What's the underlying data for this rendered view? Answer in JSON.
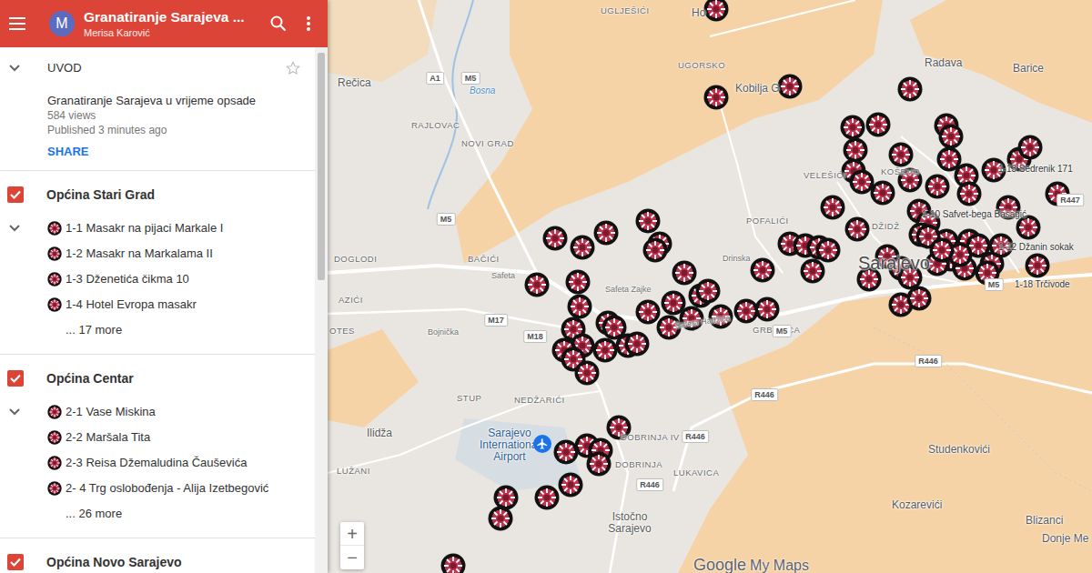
{
  "header": {
    "avatar": "M",
    "title": "Granatiranje Sarajeva ...",
    "author": "Merisa Karović"
  },
  "intro": {
    "heading": "UVOD",
    "expanded": true,
    "starred": false,
    "title": "Granatiranje Sarajeva u vrijeme opsade",
    "views": "584 views",
    "published": "Published 3 minutes ago",
    "share": "SHARE"
  },
  "layers": [
    {
      "name": "Općina Stari Grad",
      "checked": true,
      "expanded": true,
      "items": [
        "1-1 Masakr na pijaci Markale I",
        "1-2 Masakr na Markalama II",
        "1-3 Dženetića čikma 10",
        "1-4 Hotel Evropa masakr"
      ],
      "more": "... 17 more"
    },
    {
      "name": "Općina Centar",
      "checked": true,
      "expanded": true,
      "items": [
        "2-1 Vase Miskina",
        "2-2 Maršala Tita",
        "2-3 Reisa Džemaludina Čauševića",
        "2- 4 Trg oslobođenja - Alija Izetbegović"
      ],
      "more": "... 26 more"
    },
    {
      "name": "Općina Novo Sarajevo",
      "checked": true,
      "items": [],
      "more": ""
    }
  ],
  "map": {
    "place_labels": [
      {
        "text": "Rečica",
        "kind": "town"
      },
      {
        "text": "UGLJEŠIĆI",
        "kind": "district"
      },
      {
        "text": "Ho",
        "kind": "town"
      },
      {
        "text": "UGORSKO",
        "kind": "district"
      },
      {
        "text": "Radava",
        "kind": "town"
      },
      {
        "text": "Barice",
        "kind": "town"
      },
      {
        "text": "Kobilja G",
        "kind": "town"
      },
      {
        "text": "RAJLOVAC",
        "kind": "district"
      },
      {
        "text": "NOVI GRAD",
        "kind": "district"
      },
      {
        "text": "VELEŠIĆI",
        "kind": "district"
      },
      {
        "text": "KOŠEVO",
        "kind": "district"
      },
      {
        "text": "POFALIĆI",
        "kind": "district"
      },
      {
        "text": "DŽIDŽ",
        "kind": "district"
      },
      {
        "text": "Sarajevo",
        "kind": "city"
      },
      {
        "text": "DOGLODI",
        "kind": "district"
      },
      {
        "text": "BAČIĆI",
        "kind": "district"
      },
      {
        "text": "AZIĆI",
        "kind": "district"
      },
      {
        "text": "OTES",
        "kind": "district"
      },
      {
        "text": "GRBAVICA",
        "kind": "district"
      },
      {
        "text": "STUP",
        "kind": "district"
      },
      {
        "text": "NEDŽARIĆI",
        "kind": "district"
      },
      {
        "text": "Sarajevo International Airport",
        "kind": "airport"
      },
      {
        "text": "DOBRINJA IV",
        "kind": "district"
      },
      {
        "text": "DOBRINJA",
        "kind": "district"
      },
      {
        "text": "LUKAVICA",
        "kind": "district"
      },
      {
        "text": "Ilidža",
        "kind": "town"
      },
      {
        "text": "LUŽANI",
        "kind": "district"
      },
      {
        "text": "Istočno Sarajevo",
        "kind": "town"
      },
      {
        "text": "Studenkovići",
        "kind": "town"
      },
      {
        "text": "Kozarevići",
        "kind": "town"
      },
      {
        "text": "Blizanci",
        "kind": "town"
      },
      {
        "text": "Donje Me",
        "kind": "town"
      }
    ],
    "road_shields": [
      "A1",
      "M5",
      "M5",
      "M17",
      "M18",
      "M5",
      "R446",
      "R446",
      "R446",
      "R446",
      "R447",
      "M5"
    ],
    "street_labels": [
      {
        "text": "Bosna",
        "kind": "river"
      },
      {
        "text": "Safeta",
        "kind": "street"
      },
      {
        "text": "Safeta Zajke",
        "kind": "street"
      },
      {
        "text": "Drinska",
        "kind": "street"
      },
      {
        "text": "Bojnička",
        "kind": "street"
      },
      {
        "text": "Safeta Hadžića",
        "kind": "street"
      }
    ],
    "pin_labels": [
      "1-13 Sedrenik 171",
      "1-10 Safvet-bega Bašagić",
      "1-12 Džanin sokak",
      "1-18 Trčivode"
    ],
    "zoom_in": "+",
    "zoom_out": "−",
    "logo_brand": "Google",
    "logo_product": "My Maps"
  }
}
